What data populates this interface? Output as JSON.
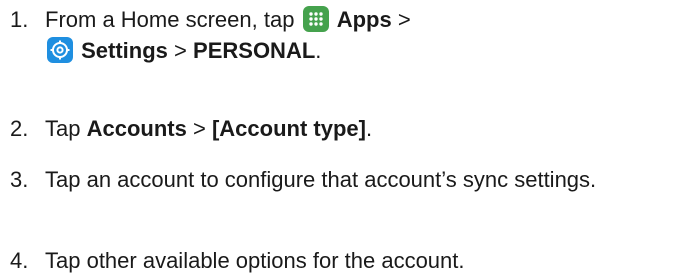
{
  "steps": [
    {
      "number": "1.",
      "text_a": "From a Home screen, tap",
      "apps_icon": "apps-grid-icon",
      "apps_label": "Apps",
      "sep_1": ">",
      "settings_icon": "settings-gear-icon",
      "settings_label": "Settings",
      "sep_2": ">",
      "personal_label": "PERSONAL",
      "end": "."
    },
    {
      "number": "2.",
      "text_a": "Tap",
      "accounts_label": "Accounts",
      "sep": ">",
      "account_type_label": "[Account type]",
      "end": "."
    },
    {
      "number": "3.",
      "text": "Tap an account to configure that account’s sync settings."
    },
    {
      "number": "4.",
      "text": "Tap other available options for the account."
    }
  ],
  "colors": {
    "apps_icon_bg": "#45a24d",
    "settings_icon_bg": "#1f8fe0"
  }
}
